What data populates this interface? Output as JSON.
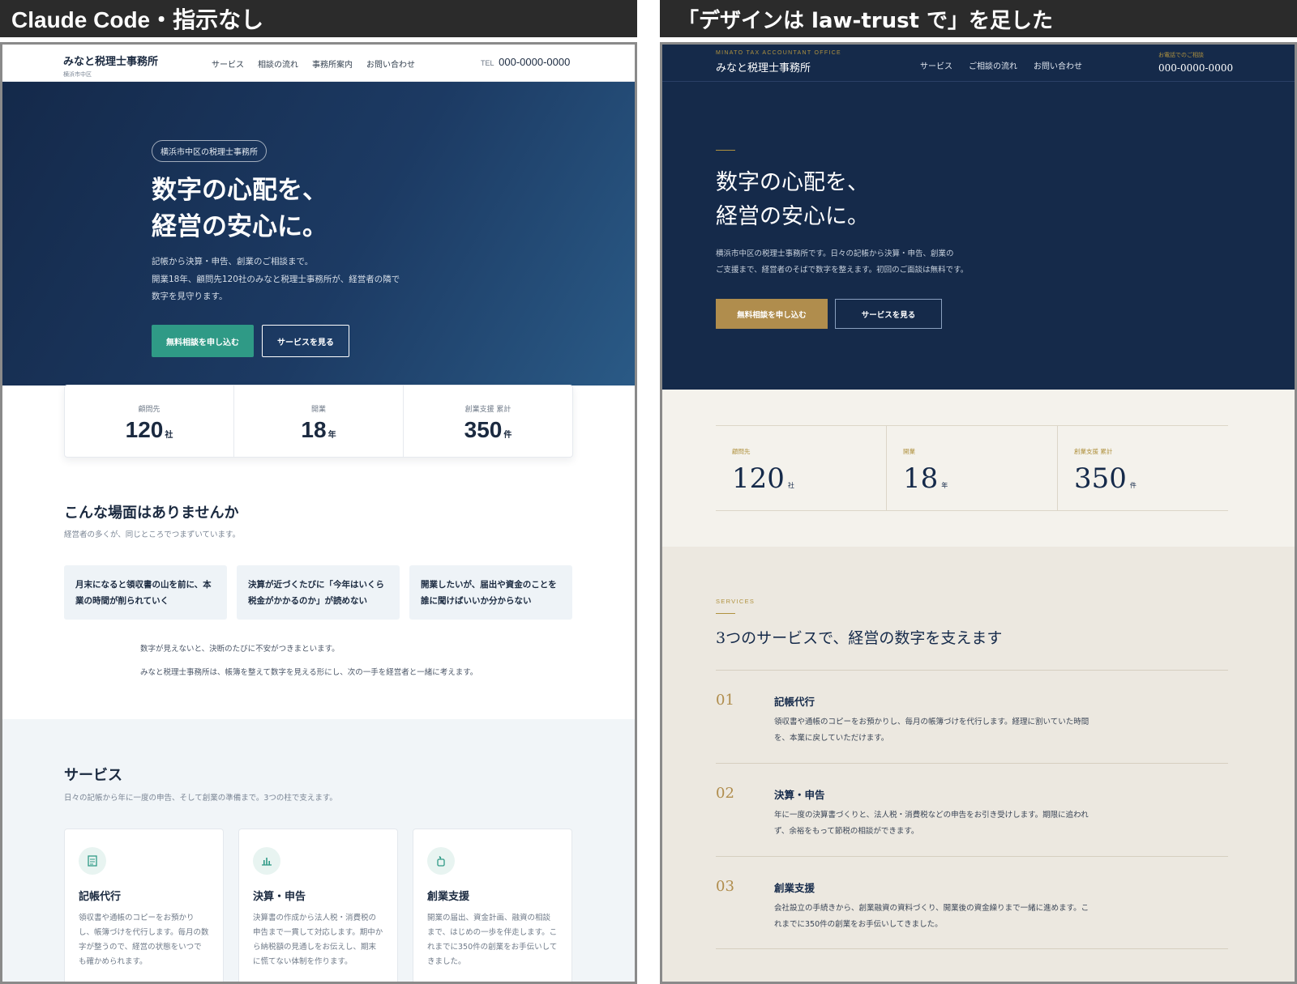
{
  "captions": {
    "left": "Claude Code・指示なし",
    "right": "「デザインは law-trust で」を足した"
  },
  "left": {
    "header": {
      "logo_name": "みなと税理士事務所",
      "logo_sub": "横浜市中区",
      "nav": [
        "サービス",
        "相談の流れ",
        "事務所案内",
        "お問い合わせ"
      ],
      "tel_label": "TEL",
      "tel_number": "000-0000-0000"
    },
    "hero": {
      "pill": "横浜市中区の税理士事務所",
      "title_line1": "数字の心配を、",
      "title_line2": "経営の安心に。",
      "lead_line1": "記帳から決算・申告、創業のご相談まで。",
      "lead_line2": "開業18年、顧問先120社のみなと税理士事務所が、経営者の隣で",
      "lead_line3": "数字を見守ります。",
      "primary_button": "無料相談を申し込む",
      "secondary_button": "サービスを見る"
    },
    "stats": [
      {
        "label": "顧問先",
        "value": "120",
        "unit": "社"
      },
      {
        "label": "開業",
        "value": "18",
        "unit": "年"
      },
      {
        "label": "創業支援 累計",
        "value": "350",
        "unit": "件"
      }
    ],
    "problems": {
      "title": "こんな場面はありませんか",
      "subtitle": "経営者の多くが、同じところでつまずいています。",
      "items": [
        "月末になると領収書の山を前に、本業の時間が削られていく",
        "決算が近づくたびに「今年はいくら税金がかかるのか」が読めない",
        "開業したいが、届出や資金のことを誰に聞けばいいか分からない"
      ],
      "note1": "数字が見えないと、決断のたびに不安がつきまといます。",
      "note2": "みなと税理士事務所は、帳簿を整えて数字を見える形にし、次の一手を経営者と一緒に考えます。"
    },
    "services": {
      "title": "サービス",
      "subtitle": "日々の記帳から年に一度の申告、そして創業の準備まで。3つの柱で支えます。",
      "cards": [
        {
          "icon": "document-icon",
          "title": "記帳代行",
          "desc": "領収書や通帳のコピーをお預かりし、帳簿づけを代行します。毎月の数字が整うので、経営の状態をいつでも確かめられます。"
        },
        {
          "icon": "bar-chart-icon",
          "title": "決算・申告",
          "desc": "決算書の作成から法人税・消費税の申告まで一貫して対応します。期中から納税額の見通しをお伝えし、期末に慌てない体制を作ります。"
        },
        {
          "icon": "seedling-icon",
          "title": "創業支援",
          "desc": "開業の届出、資金計画、融資の相談まで、はじめの一歩を伴走します。これまでに350件の創業をお手伝いしてきました。"
        }
      ]
    }
  },
  "right": {
    "header": {
      "logo_en": "MINATO TAX ACCOUNTANT OFFICE",
      "logo_name": "みなと税理士事務所",
      "nav": [
        "サービス",
        "ご相談の流れ",
        "お問い合わせ"
      ],
      "tel_label": "お電話でのご相談",
      "tel_number": "000-0000-0000"
    },
    "hero": {
      "title_line1": "数字の心配を、",
      "title_line2": "経営の安心に。",
      "lead_line1": "横浜市中区の税理士事務所です。日々の記帳から決算・申告、創業の",
      "lead_line2": "ご支援まで、経営者のそばで数字を整えます。初回のご面談は無料です。",
      "primary_button": "無料相談を申し込む",
      "secondary_button": "サービスを見る"
    },
    "stats": [
      {
        "label": "顧問先",
        "value": "120",
        "unit": "社"
      },
      {
        "label": "開業",
        "value": "18",
        "unit": "年"
      },
      {
        "label": "創業支援 累計",
        "value": "350",
        "unit": "件"
      }
    ],
    "services": {
      "kicker": "SERVICES",
      "title": "3つのサービスで、経営の数字を支えます",
      "items": [
        {
          "no": "01",
          "title": "記帳代行",
          "desc": "領収書や通帳のコピーをお預かりし、毎月の帳簿づけを代行します。経理に割いていた時間を、本業に戻していただけます。"
        },
        {
          "no": "02",
          "title": "決算・申告",
          "desc": "年に一度の決算書づくりと、法人税・消費税などの申告をお引き受けします。期限に追われず、余裕をもって節税の相談ができます。"
        },
        {
          "no": "03",
          "title": "創業支援",
          "desc": "会社設立の手続きから、創業融資の資料づくり、開業後の資金繰りまで一緒に進めます。これまでに350件の創業をお手伝いしてきました。"
        }
      ]
    }
  }
}
